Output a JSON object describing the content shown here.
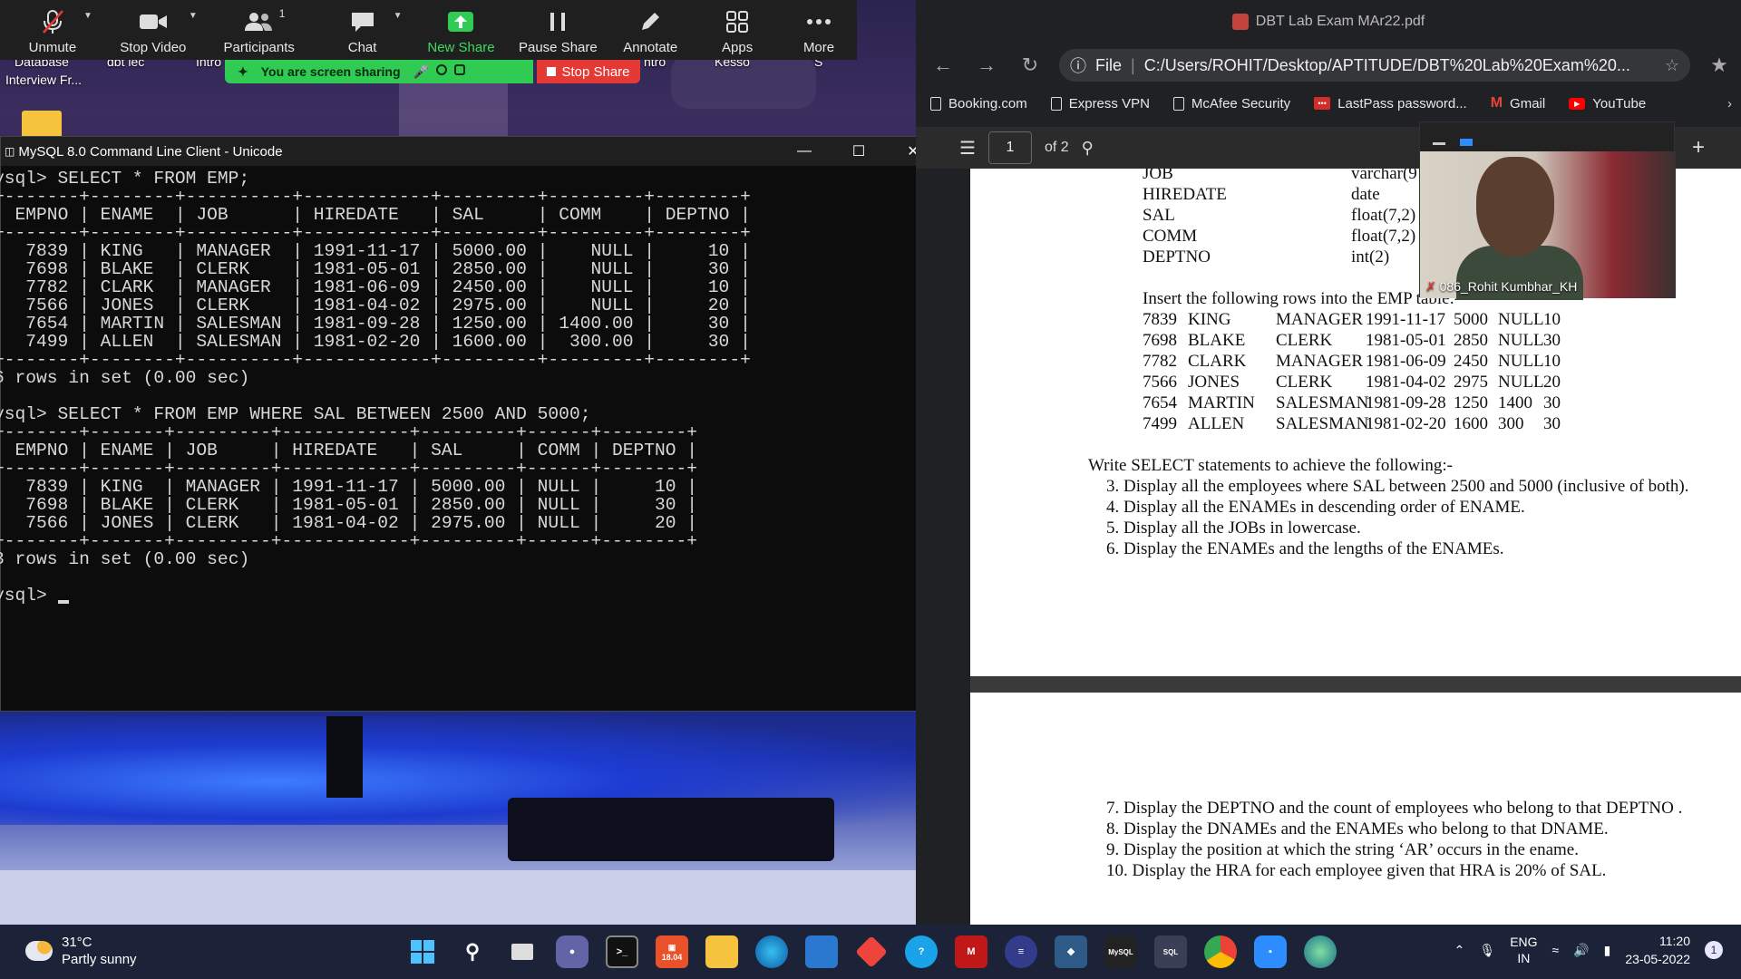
{
  "desktop": {
    "icon_labels": [
      "Database",
      "dbt lec",
      "Intro",
      "Interview Fr...",
      "ntro",
      "Kesso",
      "S"
    ]
  },
  "zoom": {
    "buttons": [
      {
        "name": "unmute",
        "label": "Unmute"
      },
      {
        "name": "stop-video",
        "label": "Stop Video"
      },
      {
        "name": "participants",
        "label": "Participants",
        "count": "1"
      },
      {
        "name": "chat",
        "label": "Chat"
      },
      {
        "name": "new-share",
        "label": "New Share"
      },
      {
        "name": "pause-share",
        "label": "Pause Share"
      },
      {
        "name": "annotate",
        "label": "Annotate"
      },
      {
        "name": "apps",
        "label": "Apps"
      },
      {
        "name": "more",
        "label": "More"
      }
    ],
    "sharing_banner": "You are screen sharing",
    "stop_share_label": "Stop Share"
  },
  "console": {
    "title": "MySQL 8.0 Command Line Client - Unicode",
    "query1": "ysql> SELECT * FROM EMP;",
    "table1_border": "-------+--------+----------+------------+---------+---------+--------+",
    "table1_header": "EMPNO | ENAME  | JOB      | HIREDATE   | SAL     | COMM    | DEPTNO |",
    "table1_rows": [
      "7839 | KING   | MANAGER  | 1991-11-17 | 5000.00 |    NULL |     10 |",
      "7698 | BLAKE  | CLERK    | 1981-05-01 | 2850.00 |    NULL |     30 |",
      "7782 | CLARK  | MANAGER  | 1981-06-09 | 2450.00 |    NULL |     10 |",
      "7566 | JONES  | CLERK    | 1981-04-02 | 2975.00 |    NULL |     20 |",
      "7654 | MARTIN | SALESMAN | 1981-09-28 | 1250.00 | 1400.00 |     30 |",
      "7499 | ALLEN  | SALESMAN | 1981-02-20 | 1600.00 |  300.00 |     30 |"
    ],
    "result1": "rows in set (0.00 sec)",
    "query2": "ysql> SELECT * FROM EMP WHERE SAL BETWEEN 2500 AND 5000;",
    "table2_border": "-------+-------+---------+------------+---------+------+--------+",
    "table2_header": "EMPNO | ENAME | JOB     | HIREDATE   | SAL     | COMM | DEPTNO |",
    "table2_rows": [
      "7839 | KING  | MANAGER | 1991-11-17 | 5000.00 | NULL |     10 |",
      "7698 | BLAKE | CLERK   | 1981-05-01 | 2850.00 | NULL |     30 |",
      "7566 | JONES | CLERK   | 1981-04-02 | 2975.00 | NULL |     20 |"
    ],
    "result2": "rows in set (0.00 sec)",
    "prompt": "ysql> "
  },
  "browser": {
    "tab_title": "DBT Lab Exam MAr22.pdf",
    "url_scheme": "File",
    "url": "C:/Users/ROHIT/Desktop/APTITUDE/DBT%20Lab%20Exam%20...",
    "bookmarks": [
      "Booking.com",
      "Express VPN",
      "McAfee Security",
      "LastPass password...",
      "Gmail",
      "YouTube"
    ],
    "page_current": "1",
    "page_total": "of 2"
  },
  "pdf": {
    "schema": [
      {
        "field": "JOB",
        "type": "varchar(9"
      },
      {
        "field": "HIREDATE",
        "type": "date"
      },
      {
        "field": "SAL",
        "type": "float(7,2)"
      },
      {
        "field": "COMM",
        "type": "float(7,2)"
      },
      {
        "field": "DEPTNO",
        "type": "int(2)"
      }
    ],
    "insert_heading": "Insert the following rows into the EMP table:-",
    "rows": [
      [
        "7839",
        "KING",
        "MANAGER",
        "1991-11-17",
        "5000",
        "NULL",
        "10"
      ],
      [
        "7698",
        "BLAKE",
        "CLERK",
        "1981-05-01",
        "2850",
        "NULL",
        "30"
      ],
      [
        "7782",
        "CLARK",
        "MANAGER",
        "1981-06-09",
        "2450",
        "NULL",
        "10"
      ],
      [
        "7566",
        "JONES",
        "CLERK",
        "1981-04-02",
        "2975",
        "NULL",
        "20"
      ],
      [
        "7654",
        "MARTIN",
        "SALESMAN",
        "1981-09-28",
        "1250",
        "1400",
        "30"
      ],
      [
        "7499",
        "ALLEN",
        "SALESMAN",
        "1981-02-20",
        "1600",
        "300",
        "30"
      ]
    ],
    "select_heading": "Write SELECT statements to achieve the following:-",
    "tasks_page1": [
      "3.  Display all the employees where SAL between 2500 and 5000 (inclusive of both).",
      "4.  Display all the ENAMEs in descending order of ENAME.",
      "5.  Display all the JOBs in lowercase.",
      "6.  Display the ENAMEs and the lengths of the ENAMEs."
    ],
    "tasks_page2": [
      "7.  Display the DEPTNO and the count of employees who belong to that DEPTNO .",
      "8.  Display the DNAMEs and the ENAMEs who belong to that DNAME.",
      "9.  Display the position at which the string ‘AR’ occurs in the ename.",
      "10. Display the HRA for each employee given that HRA is 20% of SAL."
    ]
  },
  "webcam": {
    "participant_name": "086_Rohit Kumbhar_KH"
  },
  "taskbar": {
    "temperature": "31°C",
    "weather": "Partly sunny",
    "lang_top": "ENG",
    "lang_bottom": "IN",
    "time": "11:20",
    "date": "23-05-2022",
    "notification_count": "1",
    "calendar_badge": "18.04",
    "app_icons": [
      "windows-start",
      "search",
      "task-view",
      "teams-chat",
      "terminal",
      "calendar",
      "file-explorer",
      "edge",
      "store",
      "anydesk",
      "help",
      "mcafee",
      "vpn",
      "mysql-workbench",
      "mysql-console",
      "sql-shell",
      "chrome",
      "zoom",
      "edge-dev"
    ]
  },
  "colors": {
    "zoom_green": "#2fcb52",
    "stop_red": "#e53935",
    "console_bg": "#0c0c0c",
    "browser_bg": "#202124"
  }
}
